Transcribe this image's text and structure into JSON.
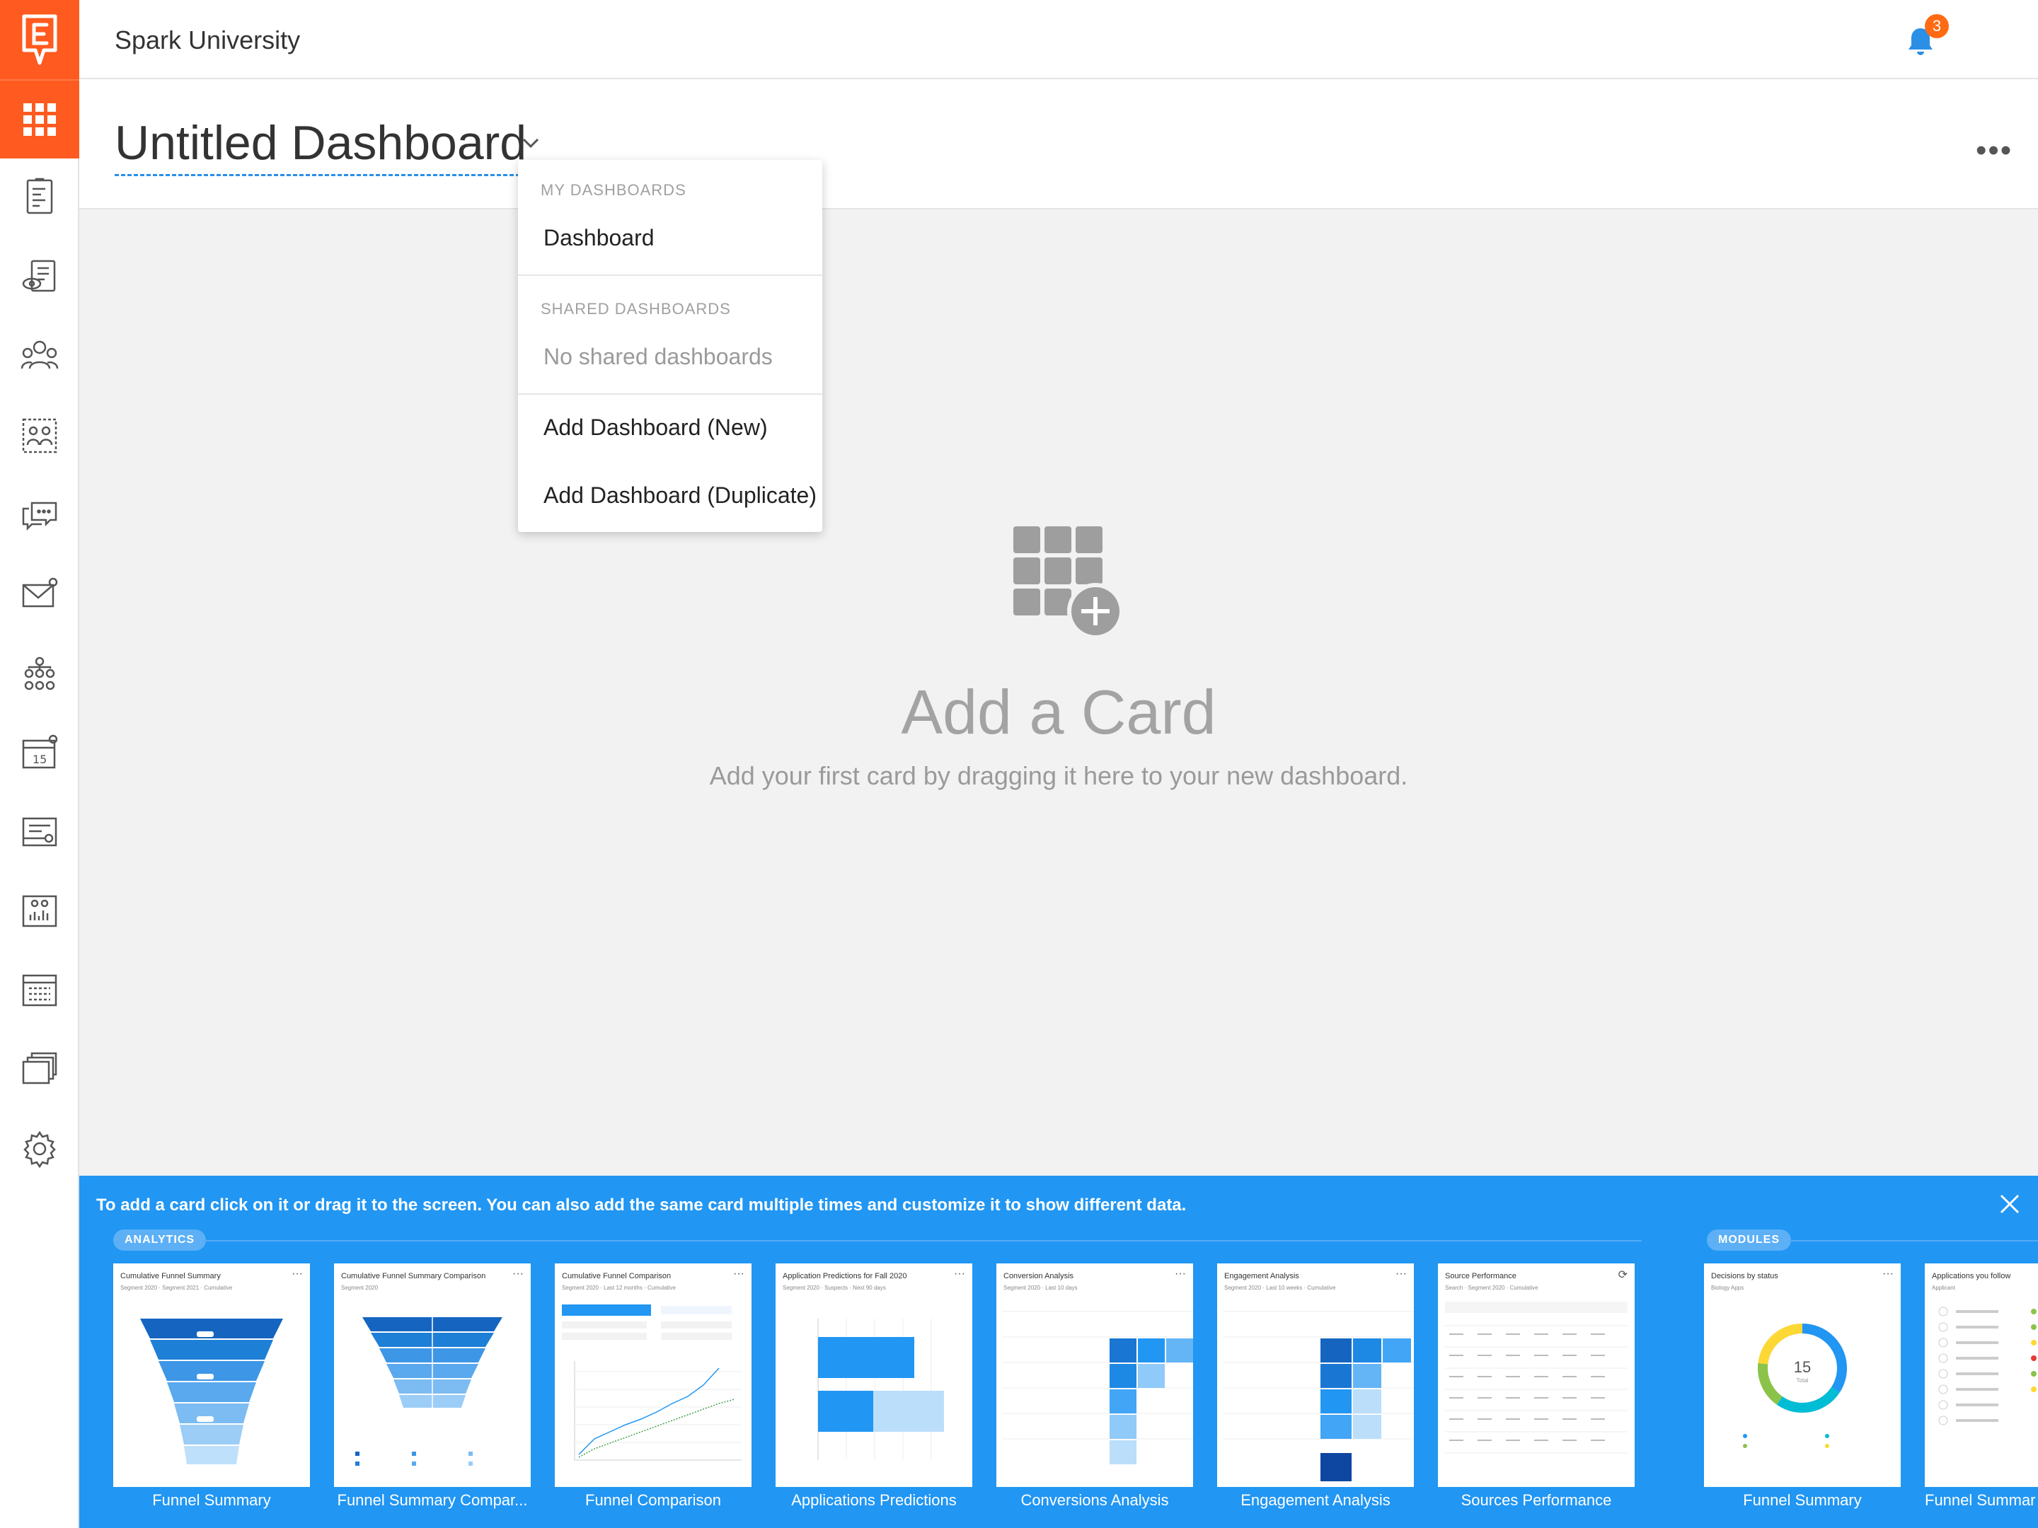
{
  "header": {
    "org_name": "Spark University",
    "notification_count": "3"
  },
  "dashboard": {
    "title": "Untitled Dashboard",
    "more_label": "•••"
  },
  "dropdown": {
    "my_section_label": "MY DASHBOARDS",
    "my_items": [
      "Dashboard"
    ],
    "shared_section_label": "SHARED DASHBOARDS",
    "shared_empty": "No shared dashboards",
    "add_new": "Add Dashboard (New)",
    "add_duplicate": "Add Dashboard (Duplicate)"
  },
  "empty_state": {
    "title": "Add a Card",
    "subtitle": "Add your first card by dragging it here to your new dashboard."
  },
  "tray": {
    "message": "To add a card click on it or drag it to the screen. You can also add the same card multiple times and customize it to show different data.",
    "analytics_tag": "ANALYTICS",
    "modules_tag": "MODULES",
    "cards": [
      {
        "label": "Funnel Summary",
        "title": "Cumulative Funnel Summary",
        "filters": "Segment 2020 · Segment 2021 · Cumulative"
      },
      {
        "label": "Funnel Summary Compar...",
        "title": "Cumulative Funnel Summary Comparison",
        "filters": "Segment 2020"
      },
      {
        "label": "Funnel Comparison",
        "title": "Cumulative Funnel Comparison",
        "filters": "Segment 2020 · Last 12 months · Cumulative"
      },
      {
        "label": "Applications Predictions",
        "title": "Application Predictions for Fall 2020",
        "filters": "Segment 2020 · Suspects · Next 90 days"
      },
      {
        "label": "Conversions Analysis",
        "title": "Conversion Analysis",
        "filters": "Segment 2020 · Last 10 days"
      },
      {
        "label": "Engagement Analysis",
        "title": "Engagement Analysis",
        "filters": "Segment 2020 · Last 10 weeks · Cumulative"
      },
      {
        "label": "Sources Performance",
        "title": "Source Performance",
        "filters": "Search · Segment 2020 · Cumulative"
      },
      {
        "label": "Funnel Summary",
        "title": "Decisions by status",
        "filters": "Biology Apps",
        "donut_value": "15",
        "donut_caption": "Total"
      },
      {
        "label": "Funnel Summar",
        "title": "Applications you follow",
        "filters": "Applicant"
      }
    ]
  },
  "colors": {
    "brand": "#ff5a1f",
    "tray": "#2196f3",
    "link": "#2b8fe6",
    "badge": "#ff6a13"
  },
  "icons": {
    "logo": "e-brand-logo-icon",
    "apps": "grid-apps-icon",
    "notifications": "bell-icon",
    "close": "close-icon",
    "chevron": "chevron-down-icon",
    "add_card": "grid-plus-icon"
  }
}
